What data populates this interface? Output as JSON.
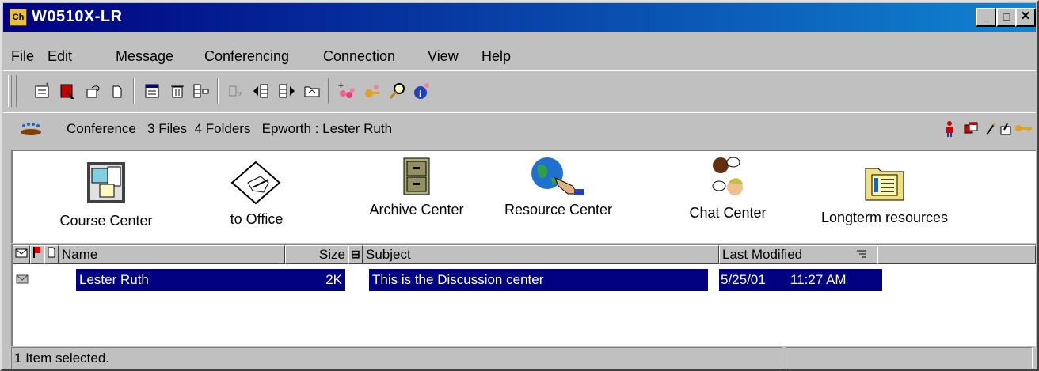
{
  "window": {
    "title": "W0510X-LR",
    "controls": {
      "minimize": "_",
      "maximize": "□",
      "close": "✕"
    }
  },
  "menu": {
    "items": [
      {
        "label": "File"
      },
      {
        "label": "Edit"
      },
      {
        "label": "Message"
      },
      {
        "label": "Conferencing"
      },
      {
        "label": "Connection"
      },
      {
        "label": "View"
      },
      {
        "label": "Help"
      }
    ]
  },
  "toolbar": {
    "icons": [
      "new-message-icon",
      "edit-message-icon",
      "reply-icon",
      "new-document-icon",
      "print-icon",
      "delete-icon",
      "properties-icon",
      "forward-icon",
      "previous-icon",
      "next-icon",
      "up-folder-icon",
      "add-users-icon",
      "key-users-icon",
      "search-icon",
      "info-icon"
    ]
  },
  "infobar": {
    "text": "Conference   3 Files  4 Folders   Epworth : Lester Ruth",
    "right_icons": [
      "person-icon",
      "windows-icon",
      "pencil-icon",
      "key-icon"
    ]
  },
  "shortcuts": [
    {
      "label": "Course Center",
      "icon": "bulletin-board-icon"
    },
    {
      "label": "to Office",
      "icon": "hand-writing-icon"
    },
    {
      "label": "Archive Center",
      "icon": "file-cabinet-icon"
    },
    {
      "label": "Resource Center",
      "icon": "globe-hand-icon"
    },
    {
      "label": "Chat Center",
      "icon": "chat-people-icon"
    },
    {
      "label": "Longterm resources",
      "icon": "folder-document-icon"
    }
  ],
  "list": {
    "columns": {
      "name": "Name",
      "size": "Size",
      "subject": "Subject",
      "modified": "Last Modified"
    },
    "rows": [
      {
        "name": "Lester Ruth",
        "size": "2K",
        "subject": "This is the Discussion center",
        "date": "5/25/01",
        "time": "11:27 AM"
      }
    ]
  },
  "status": {
    "text": "1 Item selected."
  }
}
